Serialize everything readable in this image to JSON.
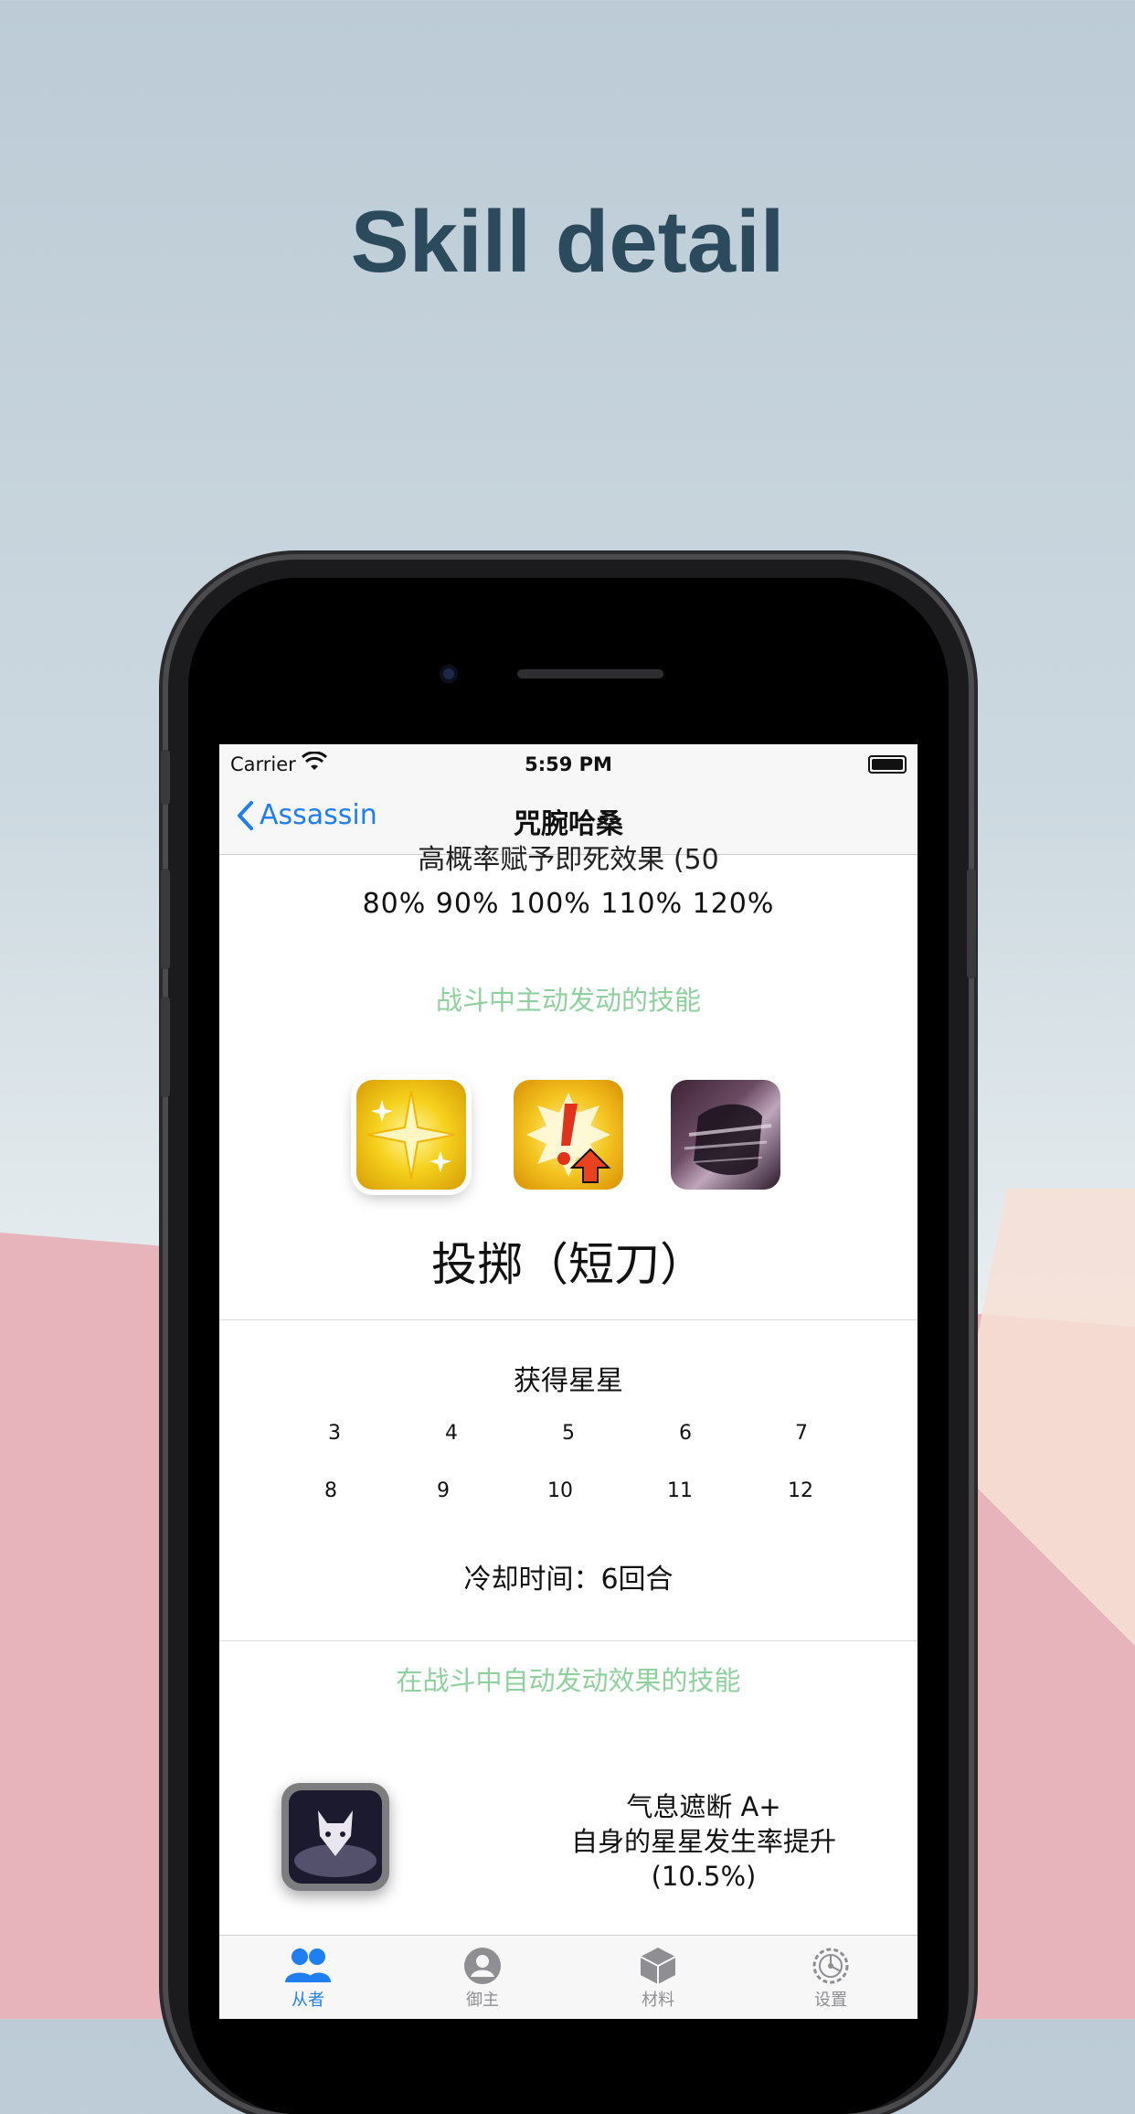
{
  "headline": "Skill detail",
  "status_bar": {
    "carrier": "Carrier",
    "time": "5:59 PM"
  },
  "nav": {
    "back_label": "Assassin",
    "title": "咒腕哈桑"
  },
  "content": {
    "cutoff_text": "高概率赋予即死效果 (50",
    "percentages": "80%  90%  100%  110%  120%",
    "active_skills_title": "战斗中主动发动的技能",
    "active_skill_icons": [
      "sparkle-skill-icon",
      "alert-up-skill-icon",
      "cloak-skill-icon"
    ],
    "selected_skill_name": "投掷（短刀）",
    "stars_title": "获得星星",
    "stars_row1": [
      "3",
      "4",
      "5",
      "6",
      "7"
    ],
    "stars_row2": [
      "8",
      "9",
      "10",
      "11",
      "12"
    ],
    "cooldown": "冷却时间：6回合",
    "passive_skills_title": "在战斗中自动发动效果的技能",
    "passive_skill": {
      "name": "气息遮断 A+",
      "effect": "自身的星星发生率提升",
      "value": "(10.5%)"
    }
  },
  "tabbar": {
    "items": [
      {
        "label": "从者",
        "icon": "people-icon",
        "active": true
      },
      {
        "label": "御主",
        "icon": "person-circle-icon",
        "active": false
      },
      {
        "label": "材料",
        "icon": "box-icon",
        "active": false
      },
      {
        "label": "设置",
        "icon": "gear-icon",
        "active": false
      }
    ]
  },
  "colors": {
    "accent": "#1f7ff0",
    "section_title": "#8fd19e",
    "headline": "#2b4a5c"
  }
}
